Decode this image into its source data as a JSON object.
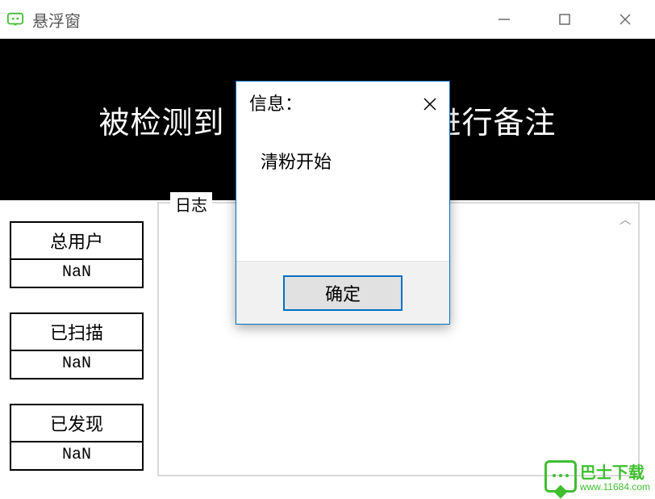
{
  "window": {
    "title": "悬浮窗"
  },
  "banner": {
    "left": "被检测到",
    "right": "进行备注"
  },
  "stats": [
    {
      "label": "总用户",
      "value": "NaN"
    },
    {
      "label": "已扫描",
      "value": "NaN"
    },
    {
      "label": "已发现",
      "value": "NaN"
    }
  ],
  "log": {
    "label": "日志"
  },
  "dialog": {
    "title": "信息：",
    "message": "清粉开始",
    "ok_label": "确定"
  },
  "watermark": {
    "name": "巴士下载",
    "url": "www.11684.com"
  }
}
